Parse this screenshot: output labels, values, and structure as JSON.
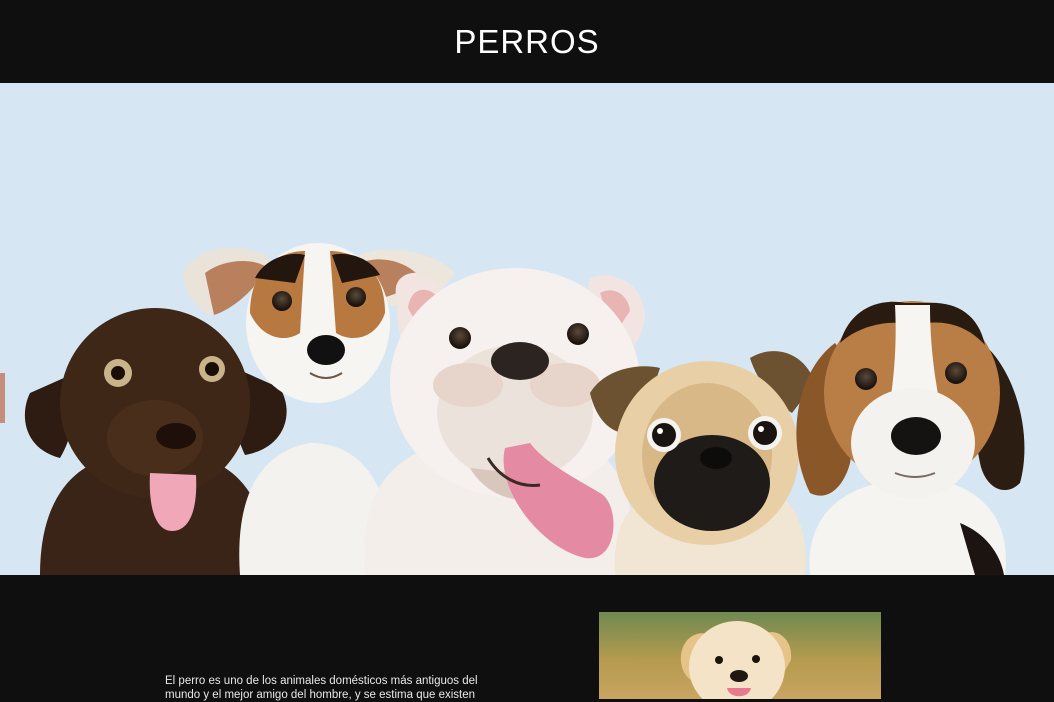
{
  "header": {
    "title": "PERROS"
  },
  "hero": {
    "image_subject": "five puppies against a light blue background",
    "dogs": [
      "chocolate-labrador-puppy",
      "jack-russell-terrier",
      "english-bulldog",
      "pug",
      "beagle"
    ],
    "background_color": "#d6e7f3"
  },
  "content": {
    "intro_text": "El perro es uno de los animales domésticos más antiguos del mundo y el mejor amigo del hombre, y se estima que existen",
    "side_image_subject": "golden retriever puppy"
  },
  "colors": {
    "header_bg": "#0f0f0f",
    "page_bg": "#0f0f0f",
    "title_color": "#ffffff",
    "hero_bg": "#d6e7f3"
  }
}
